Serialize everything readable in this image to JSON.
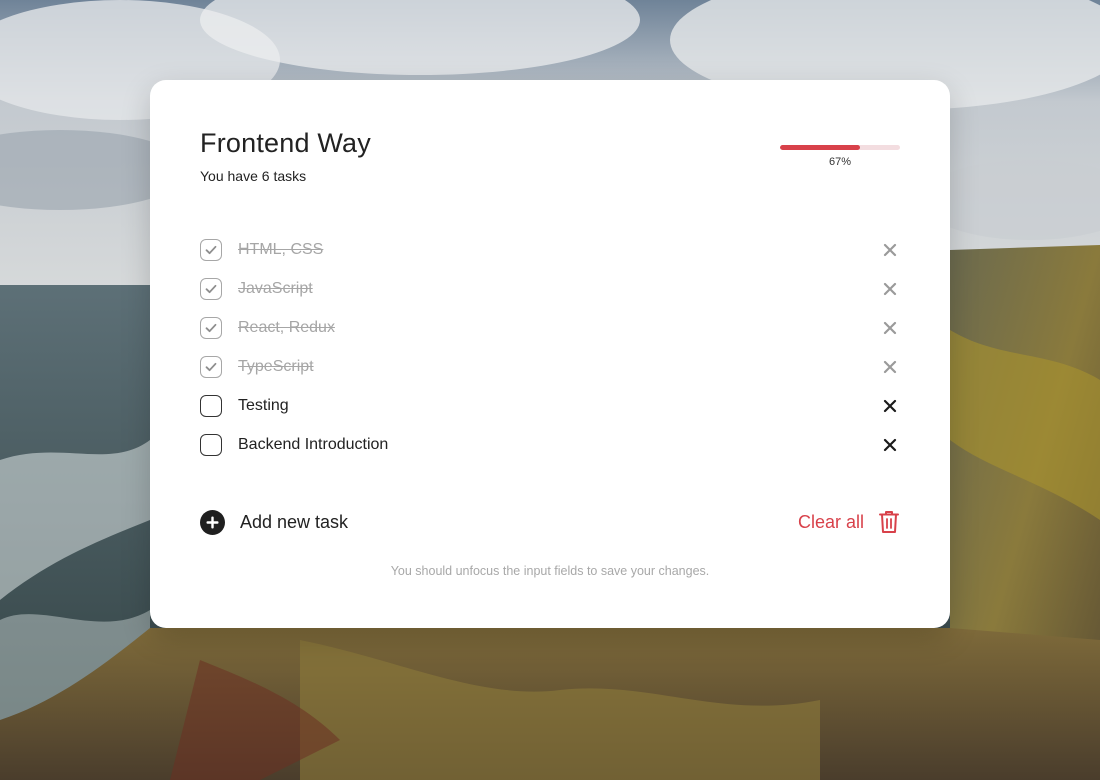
{
  "header": {
    "title": "Frontend Way",
    "subtitle": "You have 6 tasks"
  },
  "progress": {
    "fraction": 0.67,
    "text": "67%",
    "fill_color": "#d8414a",
    "track_color": "#f3dde0"
  },
  "tasks": [
    {
      "label": "HTML, CSS",
      "done": true
    },
    {
      "label": "JavaScript",
      "done": true
    },
    {
      "label": "React, Redux",
      "done": true
    },
    {
      "label": "TypeScript",
      "done": true
    },
    {
      "label": "Testing",
      "done": false
    },
    {
      "label": "Backend Introduction",
      "done": false
    }
  ],
  "actions": {
    "add_label": "Add new task",
    "clear_label": "Clear all",
    "accent_color": "#d8414a"
  },
  "hint": "You should unfocus the input fields to save your changes.",
  "icons": {
    "check": "check-icon",
    "delete": "close-icon",
    "add": "plus-circle-icon",
    "clear": "trash-icon"
  }
}
